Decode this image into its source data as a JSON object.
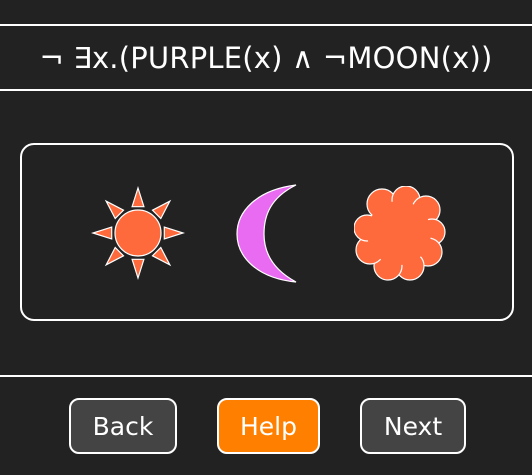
{
  "formula": "¬ ∃x.(PURPLE(x) ∧ ¬MOON(x))",
  "scene": {
    "shapes": [
      {
        "kind": "sun",
        "icon": "sun-icon",
        "color": "#ff6a3d"
      },
      {
        "kind": "moon",
        "icon": "moon-icon",
        "color": "#e86bf2"
      },
      {
        "kind": "cloud",
        "icon": "cloud-icon",
        "color": "#ff6a3d"
      }
    ]
  },
  "buttons": {
    "back_label": "Back",
    "help_label": "Help",
    "next_label": "Next"
  },
  "colors": {
    "background": "#222222",
    "button_gray": "#444444",
    "button_help": "#ff8000",
    "line": "#ffffff"
  }
}
